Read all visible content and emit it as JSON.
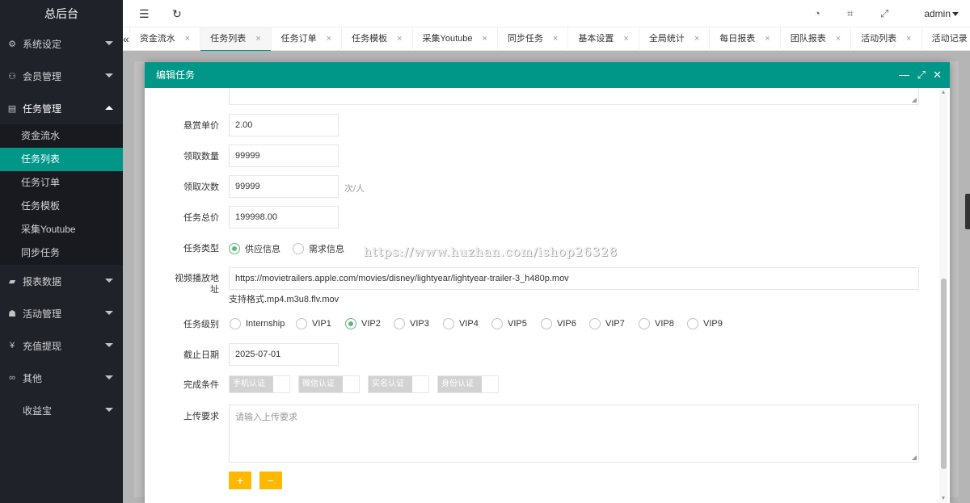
{
  "sidebar": {
    "logo": "总后台",
    "items": [
      {
        "label": "系统设定",
        "icon": "gear-icon"
      },
      {
        "label": "会员管理",
        "icon": "user-icon"
      },
      {
        "label": "任务管理",
        "icon": "document-icon"
      },
      {
        "label": "报表数据",
        "icon": "book-icon"
      },
      {
        "label": "活动管理",
        "icon": "group-icon"
      },
      {
        "label": "充值提现",
        "icon": "yen-icon"
      },
      {
        "label": "其他",
        "icon": "link-icon"
      },
      {
        "label": "收益宝",
        "icon": ""
      }
    ],
    "submenu": [
      "资金流水",
      "任务列表",
      "任务订单",
      "任务模板",
      "采集Youtube",
      "同步任务"
    ],
    "active_sub": "任务列表"
  },
  "header": {
    "user": "admin"
  },
  "tabs": [
    "资金流水",
    "任务列表",
    "任务订单",
    "任务模板",
    "采集Youtube",
    "同步任务",
    "基本设置",
    "全局统计",
    "每日报表",
    "团队报表",
    "活动列表",
    "活动记录"
  ],
  "active_tab": "任务列表",
  "modal": {
    "title": "编辑任务",
    "form": {
      "reward_price": {
        "label": "悬赏单价",
        "value": "2.00"
      },
      "claim_quantity": {
        "label": "领取数量",
        "value": "99999"
      },
      "claim_times": {
        "label": "领取次数",
        "value": "99999",
        "unit": "次/人"
      },
      "total_price": {
        "label": "任务总价",
        "value": "199998.00"
      },
      "task_type": {
        "label": "任务类型",
        "options": [
          "供应信息",
          "需求信息"
        ],
        "selected": "供应信息"
      },
      "video_url": {
        "label_line1": "视频播放地",
        "label_line2": "址",
        "value": "https://movietrailers.apple.com/movies/disney/lightyear/lightyear-trailer-3_h480p.mov",
        "tip": "支持格式.mp4.m3u8.flv.mov"
      },
      "task_level": {
        "label": "任务级别",
        "options": [
          "Internship",
          "VIP1",
          "VIP2",
          "VIP3",
          "VIP4",
          "VIP5",
          "VIP6",
          "VIP7",
          "VIP8",
          "VIP9"
        ],
        "selected": "VIP2"
      },
      "deadline": {
        "label": "截止日期",
        "value": "2025-07-01"
      },
      "conditions": {
        "label": "完成条件",
        "switches": [
          "手机认证",
          "微信认证",
          "实名认证",
          "身份认证"
        ]
      },
      "upload_req": {
        "label": "上传要求",
        "placeholder": "请输入上传要求"
      },
      "add_label": "+",
      "remove_label": "−"
    }
  },
  "watermark": "https://www.huzhan.com/ishop26328",
  "colors": {
    "accent": "#009688",
    "sidebar": "#20222a",
    "warn": "#ffb800",
    "radio": "#5fb878"
  }
}
